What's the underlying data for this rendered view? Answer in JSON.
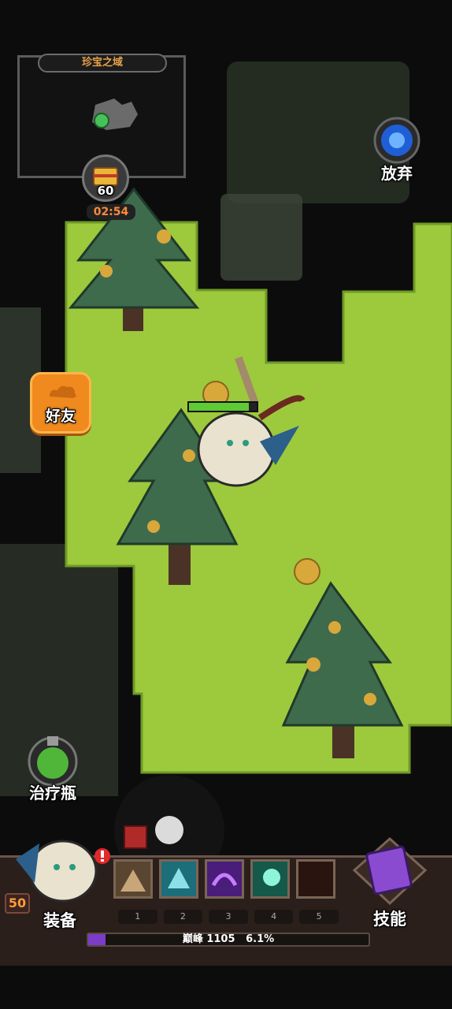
{
  "minimap": {
    "title": "珍宝之域"
  },
  "chest": {
    "count": "60"
  },
  "timer": "02:54",
  "buttons": {
    "abandon": "放弃",
    "friends": "好友",
    "potion": "治疗瓶",
    "equip": "装备",
    "skills": "技能"
  },
  "player": {
    "level": "50",
    "hp_fraction": 0.88
  },
  "skill_slot_numbers": [
    "1",
    "2",
    "3",
    "4",
    "5"
  ],
  "progress": {
    "label": "巅峰 1105",
    "percent_text": "6.1%",
    "fraction": 0.061
  },
  "colors": {
    "grass": "#9dc93d",
    "accent_orange": "#f08a1e",
    "xp_purple": "#7c3cc8"
  }
}
